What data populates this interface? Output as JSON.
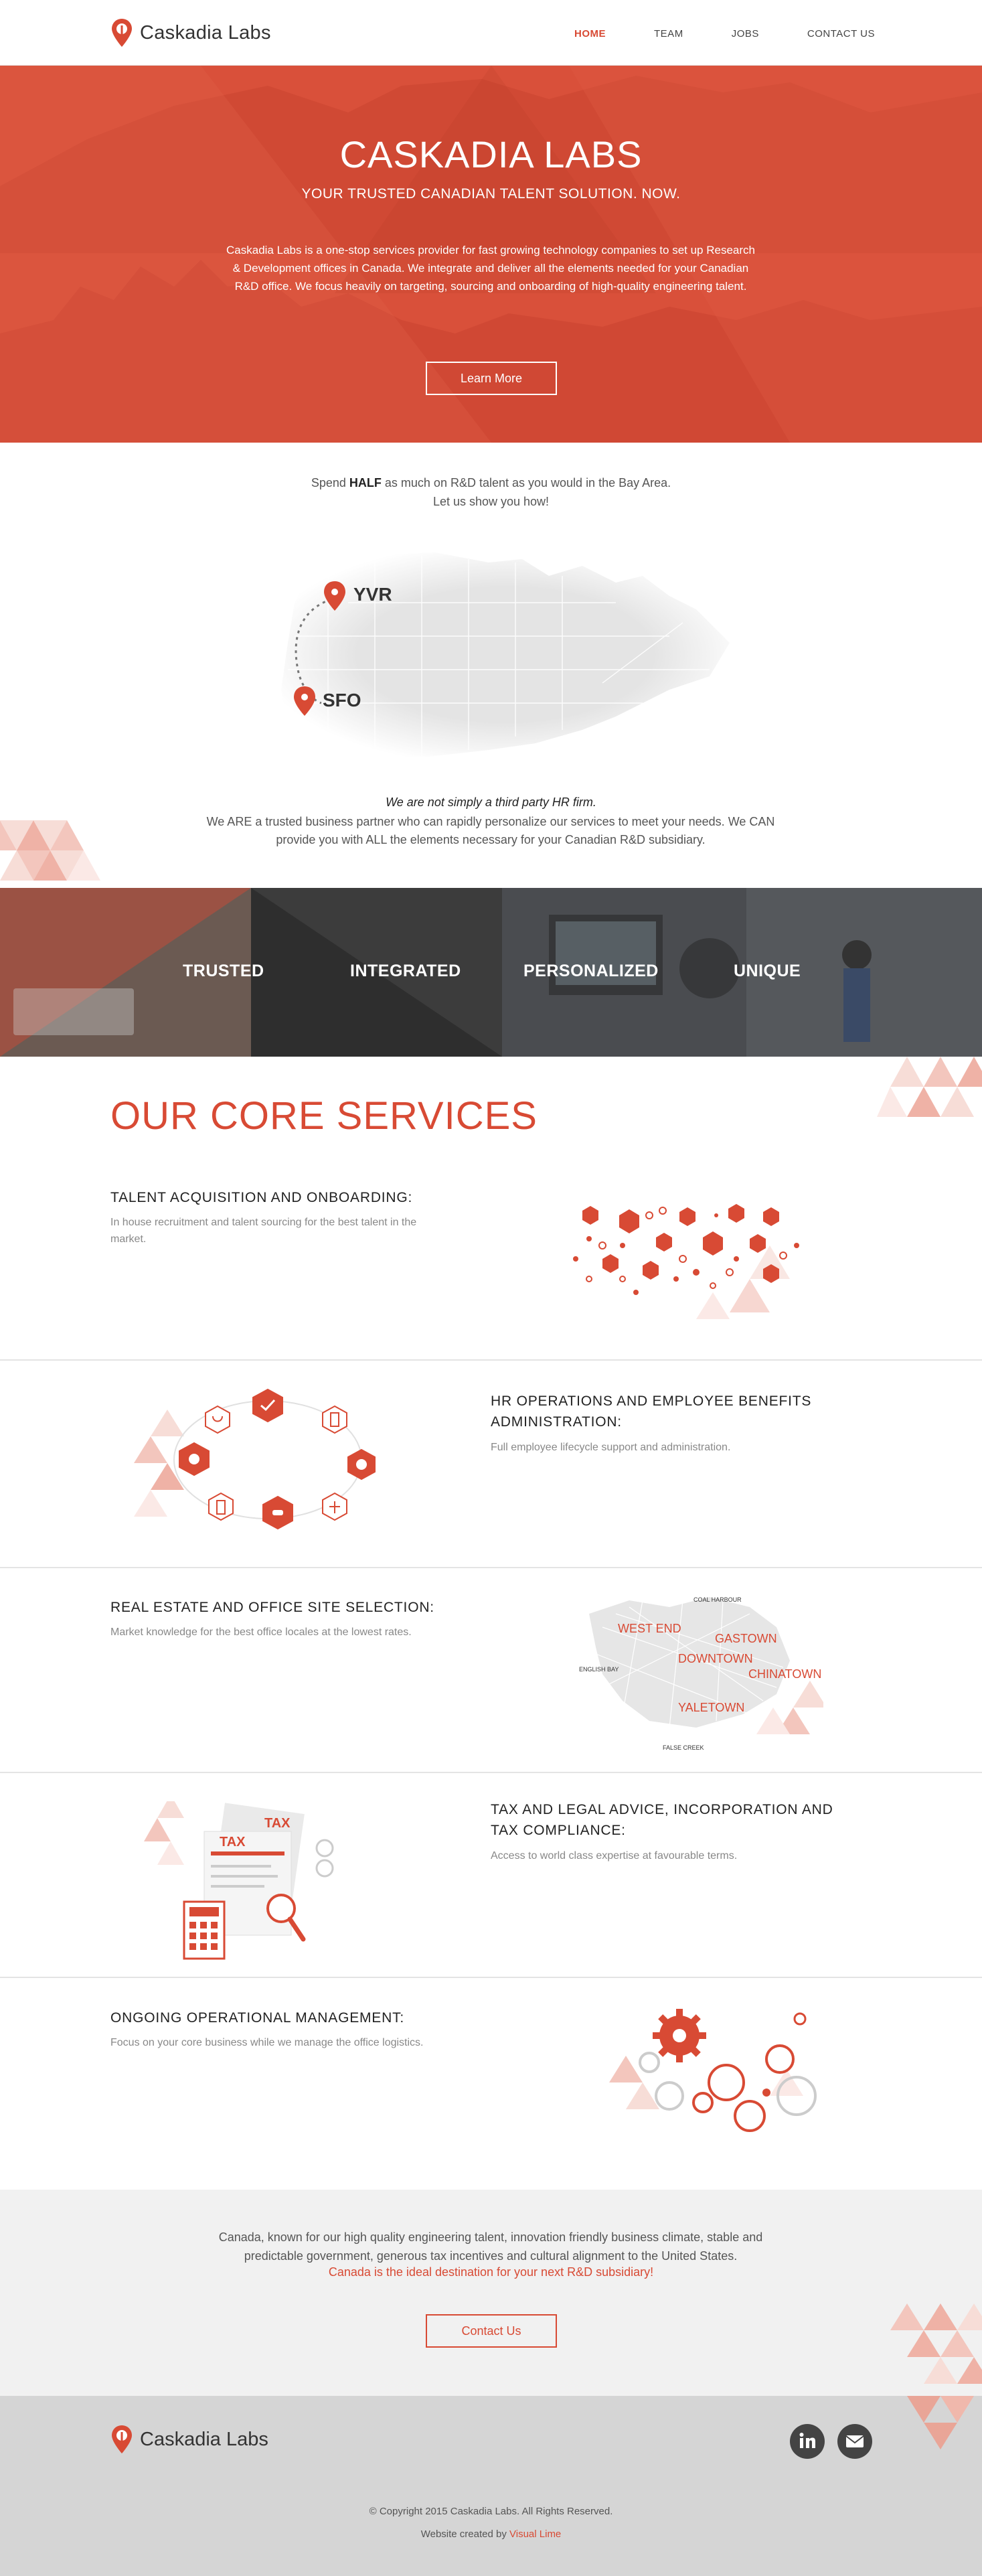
{
  "brand": {
    "name": "Caskadia Labs",
    "accent": "#d84a34"
  },
  "nav": {
    "items": [
      {
        "label": "HOME",
        "active": true
      },
      {
        "label": "TEAM",
        "active": false
      },
      {
        "label": "JOBS",
        "active": false
      },
      {
        "label": "CONTACT US",
        "active": false
      }
    ]
  },
  "hero": {
    "title": "CASKADIA LABS",
    "subtitle": "YOUR TRUSTED CANADIAN TALENT SOLUTION. NOW.",
    "description": "Caskadia Labs is a one-stop services provider for fast growing technology companies to set up Research & Development offices in Canada.  We integrate and deliver all the elements needed for your Canadian R&D office. We focus heavily on targeting, sourcing and onboarding of high-quality engineering talent.",
    "button": "Learn More"
  },
  "intro": {
    "prefix": "Spend ",
    "emphasis": "HALF",
    "suffix": " as much on R&D talent as you would in the Bay Area.",
    "line2": "Let us show you how!"
  },
  "map": {
    "labels": [
      "YVR",
      "SFO"
    ]
  },
  "partner": {
    "title": "We are not simply a third party HR firm.",
    "description": "We ARE a trusted business partner who can rapidly personalize our services to meet your needs. We CAN provide you with ALL the elements necessary for your Canadian R&D subsidiary."
  },
  "values": [
    "TRUSTED",
    "INTEGRATED",
    "PERSONALIZED",
    "UNIQUE"
  ],
  "services": {
    "heading": "OUR CORE SERVICES",
    "items": [
      {
        "title": "TALENT ACQUISITION AND ONBOARDING:",
        "description": "In house recruitment and talent sourcing for the best talent in the market."
      },
      {
        "title": "HR OPERATIONS AND EMPLOYEE BENEFITS ADMINISTRATION:",
        "description": "Full employee lifecycle support and administration."
      },
      {
        "title": "REAL ESTATE AND OFFICE SITE SELECTION:",
        "description": "Market knowledge for the best office locales at the lowest rates."
      },
      {
        "title": "TAX AND LEGAL ADVICE, INCORPORATION AND TAX COMPLIANCE:",
        "description": "Access to world class expertise at favourable terms."
      },
      {
        "title": "ONGOING OPERATIONAL MANAGEMENT:",
        "description": "Focus on your core business while we manage the office logistics."
      }
    ],
    "map_labels": {
      "small": [
        "COAL HARBOUR",
        "ENGLISH BAY",
        "FALSE CREEK"
      ],
      "large": [
        "WEST END",
        "GASTOWN",
        "DOWNTOWN",
        "CHINATOWN",
        "YALETOWN"
      ]
    },
    "tax_label": "TAX"
  },
  "cta": {
    "text": "Canada, known for our high quality engineering talent, innovation friendly business climate, stable and predictable government, generous tax incentives and cultural alignment to the United States.",
    "highlight": "Canada is the ideal destination for your next R&D subsidiary!",
    "button": "Contact Us"
  },
  "footer": {
    "copyright": "© Copyright 2015 Caskadia Labs. All Rights Reserved.",
    "credit_prefix": "Website created by ",
    "credit_link": "Visual Lime"
  },
  "icons": [
    "location-pin-icon",
    "linkedin-icon",
    "email-icon"
  ]
}
